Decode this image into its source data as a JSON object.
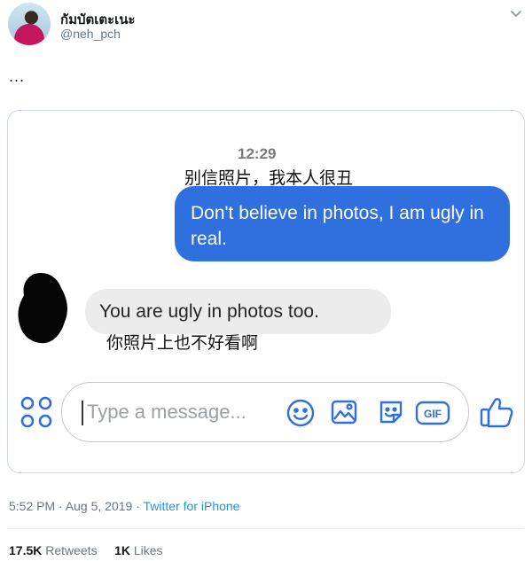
{
  "tweet": {
    "display_name": "กัมบัตเตะเนะ",
    "handle": "@neh_pch",
    "body": "...",
    "timestamp": "5:52 PM · Aug 5, 2019",
    "meta_separator": " · ",
    "source": "Twitter for iPhone",
    "retweets_count": "17.5K",
    "retweets_label": "Retweets",
    "likes_count": "1K",
    "likes_label": "Likes"
  },
  "image": {
    "time": "12:29",
    "caption_top_cn": "别信照片，我本人很丑",
    "sent_message": "Don't believe in photos, I am ugly in real.",
    "received_message": "You are ugly in photos too.",
    "caption_bottom_cn": "你照片上也不好看啊",
    "composer_placeholder": "Type a message...",
    "gif_label": "GIF",
    "colors": {
      "sent_bubble": "#2f6fde",
      "received_bubble": "#ececec",
      "icon_blue": "#2f6fde"
    }
  },
  "icons": [
    "avatar",
    "caret-down-icon",
    "apps-grid-icon",
    "smile-icon",
    "image-icon",
    "sticker-icon",
    "gif-icon",
    "thumbs-up-icon"
  ]
}
